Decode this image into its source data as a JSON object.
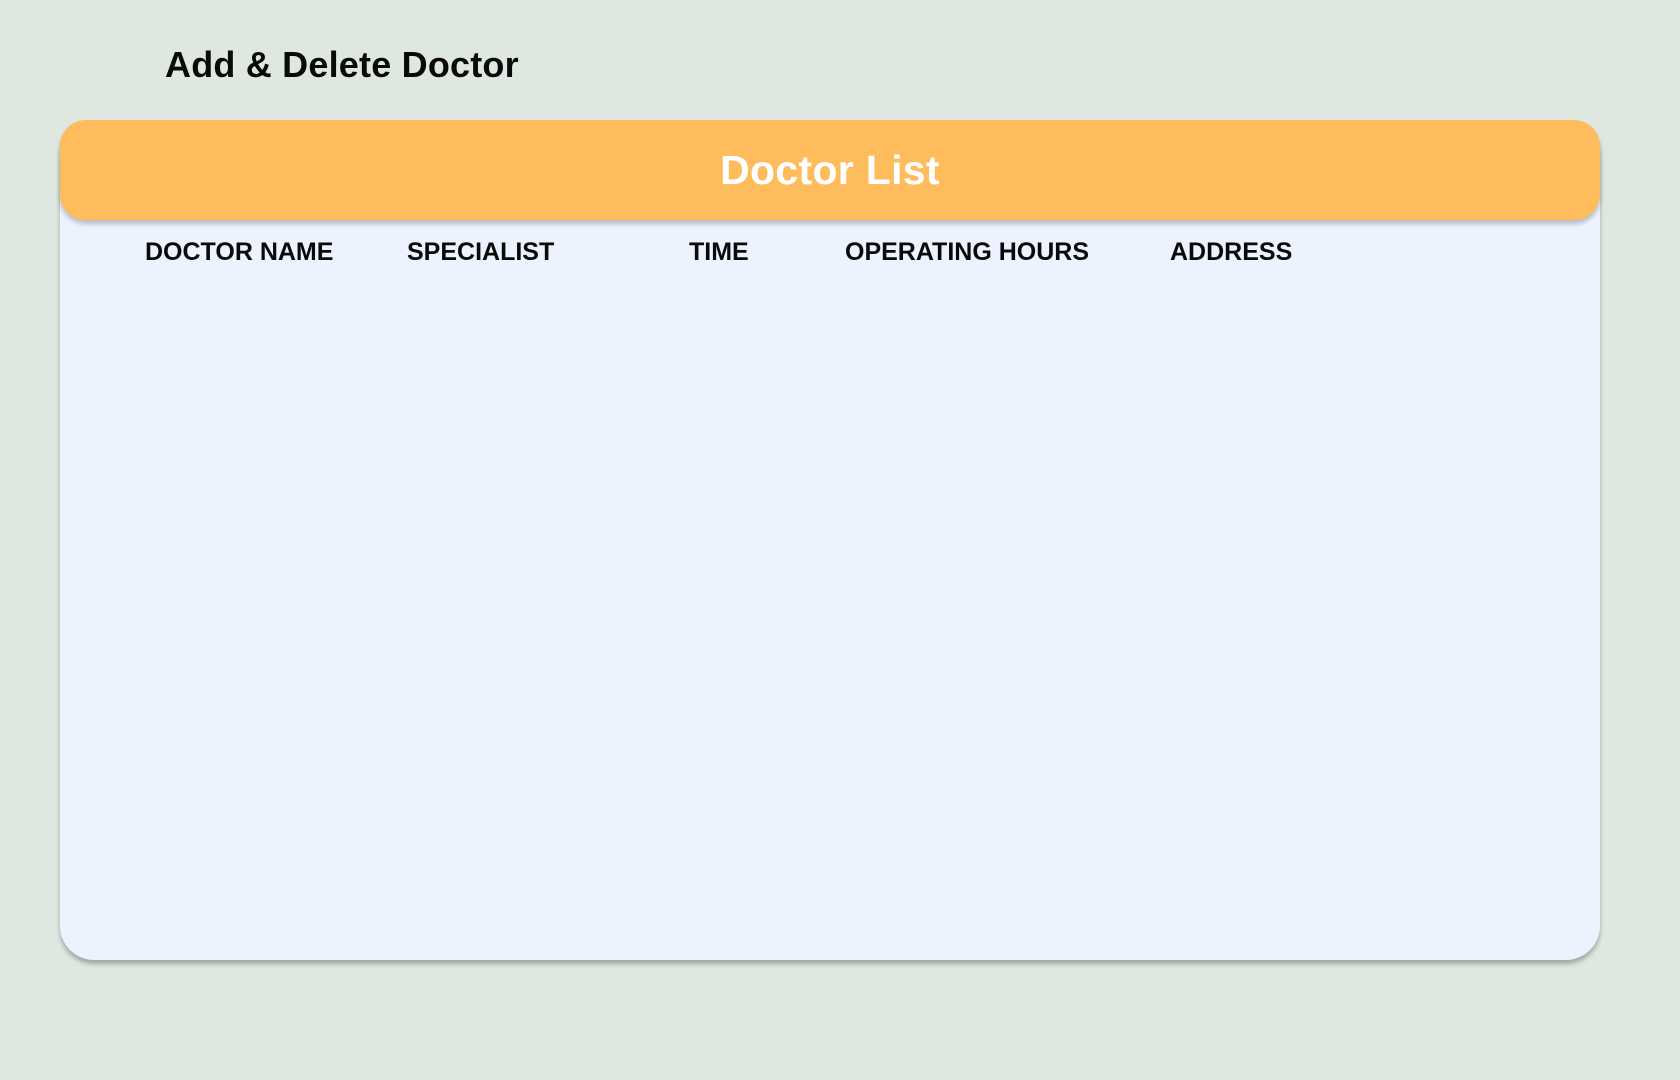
{
  "page": {
    "title": "Add & Delete Doctor"
  },
  "card": {
    "title": "Doctor List",
    "columns": [
      "DOCTOR NAME",
      "SPECIALIST",
      "TIME",
      "OPERATING HOURS",
      "ADDRESS"
    ],
    "rows": []
  },
  "colors": {
    "background": "#dfe8e0",
    "card_background": "#ecf2fe",
    "header_accent": "#ffbc5c",
    "header_text": "#ffffff",
    "text": "#0a0a0a"
  }
}
